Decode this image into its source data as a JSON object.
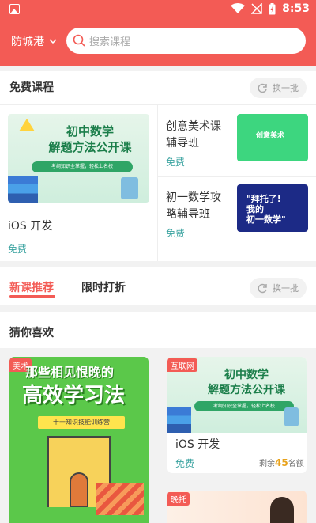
{
  "status_bar": {
    "time": "8:53"
  },
  "header": {
    "city": "防城港",
    "search_placeholder": "搜索课程"
  },
  "free_courses": {
    "title": "免费课程",
    "refresh_label": "换一批",
    "featured": {
      "banner_title": "初中数学\n解题方法公开课",
      "banner_sub": "考纲知识全掌握，轻松上名校",
      "name": "iOS 开发",
      "price": "免费"
    },
    "side": [
      {
        "name": "创意美术课\n辅导班",
        "price": "免费",
        "thumb_text": "创意美术"
      },
      {
        "name": "初一数学攻\n略辅导班",
        "price": "免费",
        "thumb_text": "\"拜托了!\n我的\n初一数学\""
      }
    ]
  },
  "tabs": {
    "items": [
      "新课推荐",
      "限时打折"
    ],
    "refresh_label": "换一批"
  },
  "guess": {
    "title": "猜你喜欢",
    "left_card": {
      "badge": "美术",
      "line1": "那些相见恨晚的",
      "line2": "高效学习法",
      "ribbon": "十一知识技能训练营"
    },
    "right_card": {
      "badge": "互联网",
      "banner_title": "初中数学\n解题方法公开课",
      "banner_sub": "考纲知识全掌握，轻松上名校",
      "name": "iOS 开发",
      "price": "免费",
      "remain_prefix": "剩余",
      "remain_count": "45",
      "remain_suffix": "名额"
    },
    "bottom_badge": "晚托"
  },
  "colors": {
    "brand": "#f35b55",
    "free": "#3aa3a0",
    "accent": "#e8a21b"
  }
}
